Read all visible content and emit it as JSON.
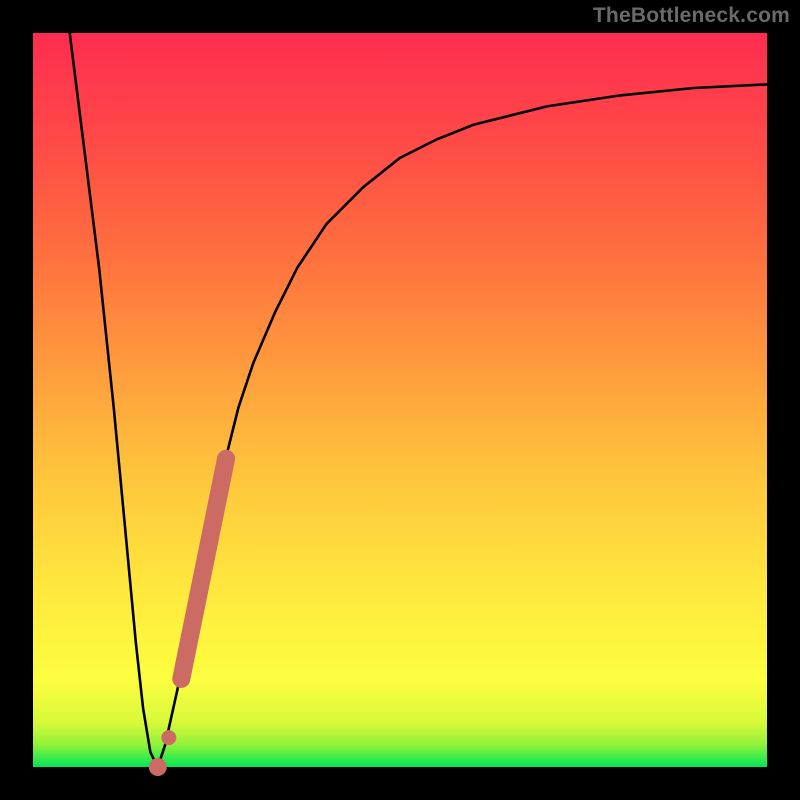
{
  "watermark": "TheBottleneck.com",
  "colors": {
    "frame": "#000000",
    "curve": "#000000",
    "marker": "#cc6b63",
    "gradient_top": "#ff2c50",
    "gradient_bottom": "#00e756"
  },
  "chart_data": {
    "type": "line",
    "title": "",
    "xlabel": "",
    "ylabel": "",
    "xlim": [
      0,
      100
    ],
    "ylim": [
      0,
      100
    ],
    "grid": false,
    "series": [
      {
        "name": "bottleneck-curve",
        "x": [
          5,
          7,
          9,
          11,
          12.5,
          14,
          15,
          16,
          17,
          18,
          20,
          22,
          24,
          26,
          28,
          30,
          33,
          36,
          40,
          45,
          50,
          55,
          60,
          70,
          80,
          90,
          100
        ],
        "values": [
          100,
          84,
          68,
          49,
          33,
          17,
          8,
          2,
          0,
          3,
          12,
          22,
          32,
          41,
          49,
          55,
          62,
          68,
          74,
          79,
          83,
          85.5,
          87.5,
          90,
          91.5,
          92.5,
          93
        ]
      }
    ],
    "annotations": [
      {
        "name": "highlight-segment",
        "kind": "thick-line",
        "color": "#cc6b63",
        "points_x": [
          20.2,
          26.3
        ],
        "points_y": [
          12,
          42
        ]
      },
      {
        "name": "highlight-dot-1",
        "kind": "dot",
        "color": "#cc6b63",
        "x": 18.5,
        "y": 4
      },
      {
        "name": "highlight-dot-2",
        "kind": "dot",
        "color": "#cc6b63",
        "x": 17,
        "y": 0
      }
    ]
  }
}
